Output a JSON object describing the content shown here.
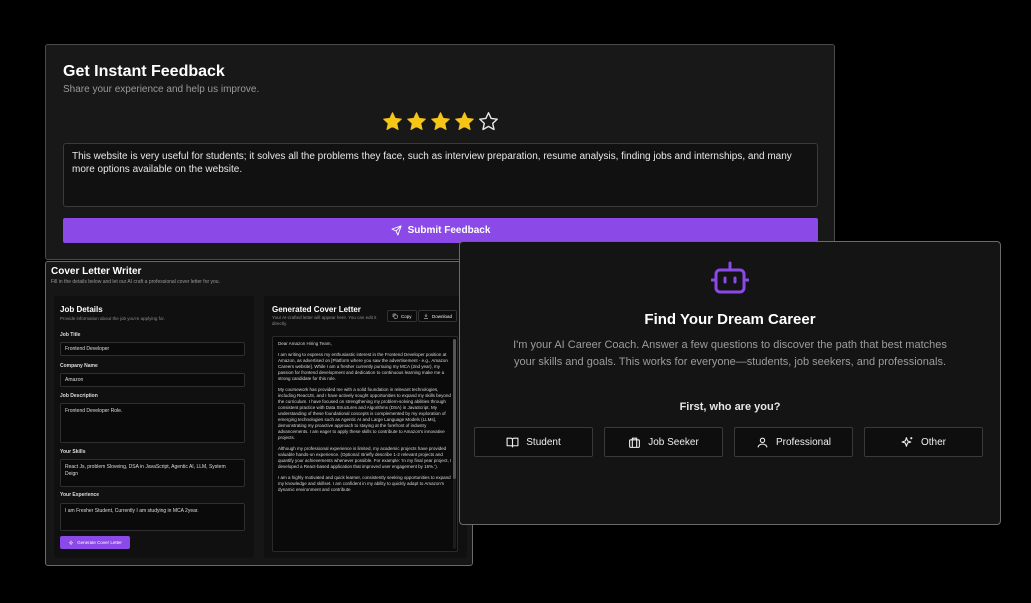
{
  "feedback": {
    "title": "Get Instant Feedback",
    "subtitle": "Share your experience and help us improve.",
    "rating": 4,
    "rating_max": 5,
    "star_color": "#f5c518",
    "text": "This website is very useful for students; it solves all the problems they face, such as interview preparation, resume analysis, finding jobs and internships, and many more options available on the website.",
    "submit_label": "Submit Feedback",
    "accent": "#8b49e8"
  },
  "cover_letter": {
    "title": "Cover Letter Writer",
    "subtitle": "Fill in the details below and let our AI craft a professional cover letter for you.",
    "job_details": {
      "title": "Job Details",
      "subtitle": "Provide information about the job you're applying for.",
      "job_title_label": "Job Title",
      "job_title_value": "Frontend Developer",
      "company_label": "Company Name",
      "company_value": "Amazon",
      "description_label": "Job Description",
      "description_value": "Frontend Developer Role.",
      "skills_label": "Your Skills",
      "skills_value": "React Js, problem Sloveing, DSA in JavaScript, Agentic AI, LLM, System Deign",
      "experience_label": "Your Experience",
      "experience_value": "I am Fresher Student, Currently I am studying in MCA 2year.",
      "generate_label": "Generate Cover Letter"
    },
    "generated": {
      "title": "Generated Cover Letter",
      "subtitle": "Your AI-crafted letter will appear here. You can edit it directly.",
      "copy_label": "Copy",
      "download_label": "Download",
      "paragraphs": [
        "Dear Amazon Hiring Team,",
        "I am writing to express my enthusiastic interest in the Frontend Developer position at Amazon, as advertised on [Platform where you saw the advertisement - e.g., Amazon Careers website]. While I am a fresher currently pursuing my MCA (2nd year), my passion for frontend development and dedication to continuous learning make me a strong candidate for this role.",
        "My coursework has provided me with a solid foundation in relevant technologies, including ReactJS, and I have actively sought opportunities to expand my skills beyond the curriculum. I have focused on strengthening my problem-solving abilities through consistent practice with Data Structures and Algorithms (DSA) in JavaScript. My understanding of these foundational concepts is complemented by my exploration of emerging technologies such as Agentic AI and Large Language Models (LLMs), demonstrating my proactive approach to staying at the forefront of industry advancements. I am eager to apply these skills to contribute to Amazon's innovative projects.",
        "Although my professional experience is limited, my academic projects have provided valuable hands-on experience. (Optional: Briefly describe 1-2 relevant projects and quantify your achievements whenever possible. For example: 'In my final year project, I developed a React-based application that improved user engagement by 15%.').",
        "I am a highly motivated and quick learner, consistently seeking opportunities to expand my knowledge and skillset. I am confident in my ability to quickly adapt to Amazon's dynamic environment and contribute"
      ]
    }
  },
  "career": {
    "icon": "robot-icon",
    "title": "Find Your Dream Career",
    "description": "I'm your AI Career Coach. Answer a few questions to discover the path that best matches your skills and goals. This works for everyone—students, job seekers, and professionals.",
    "question": "First, who are you?",
    "options": [
      {
        "label": "Student",
        "icon": "book-icon"
      },
      {
        "label": "Job Seeker",
        "icon": "briefcase-icon"
      },
      {
        "label": "Professional",
        "icon": "user-icon"
      },
      {
        "label": "Other",
        "icon": "sparkles-icon"
      }
    ]
  }
}
